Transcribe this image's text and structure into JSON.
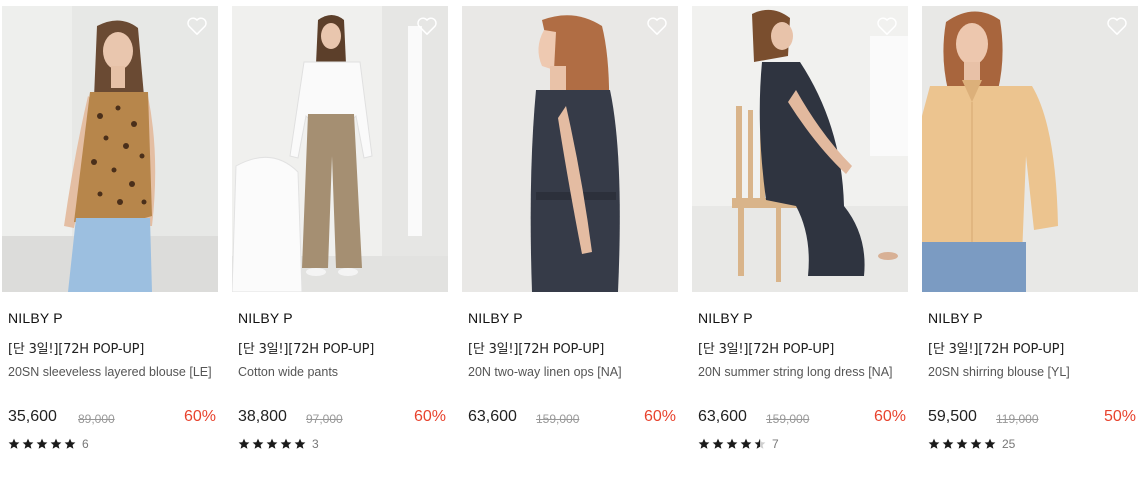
{
  "products": [
    {
      "brand": "NILBY P",
      "promo": "[단 3일!][72H POP-UP]",
      "name": "20SN sleeveless layered blouse [LE]",
      "price": "35,600",
      "original_price": "89,000",
      "discount": "60%",
      "rating": 5,
      "review_count": "6",
      "image": "model-leopard-camisole"
    },
    {
      "brand": "NILBY P",
      "promo": "[단 3일!][72H POP-UP]",
      "name": "Cotton wide pants",
      "price": "38,800",
      "original_price": "97,000",
      "discount": "60%",
      "rating": 5,
      "review_count": "3",
      "image": "model-wide-pants"
    },
    {
      "brand": "NILBY P",
      "promo": "[단 3일!][72H POP-UP]",
      "name": "20N two-way linen ops [NA]",
      "price": "63,600",
      "original_price": "159,000",
      "discount": "60%",
      "rating": null,
      "review_count": null,
      "image": "model-navy-linen-dress"
    },
    {
      "brand": "NILBY P",
      "promo": "[단 3일!][72H POP-UP]",
      "name": "20N summer string long dress [NA]",
      "price": "63,600",
      "original_price": "159,000",
      "discount": "60%",
      "rating": 4.5,
      "review_count": "7",
      "image": "model-long-dress-chair"
    },
    {
      "brand": "NILBY P",
      "promo": "[단 3일!][72H POP-UP]",
      "name": "20SN shirring blouse [YL]",
      "price": "59,500",
      "original_price": "119,000",
      "discount": "50%",
      "rating": 5,
      "review_count": "25",
      "image": "model-yellow-blouse"
    }
  ],
  "icons": {
    "wishlist": "heart-outline-icon",
    "rating": "star-icon"
  },
  "colors": {
    "discount": "#e8432e",
    "text": "#222222",
    "muted": "#999999"
  }
}
